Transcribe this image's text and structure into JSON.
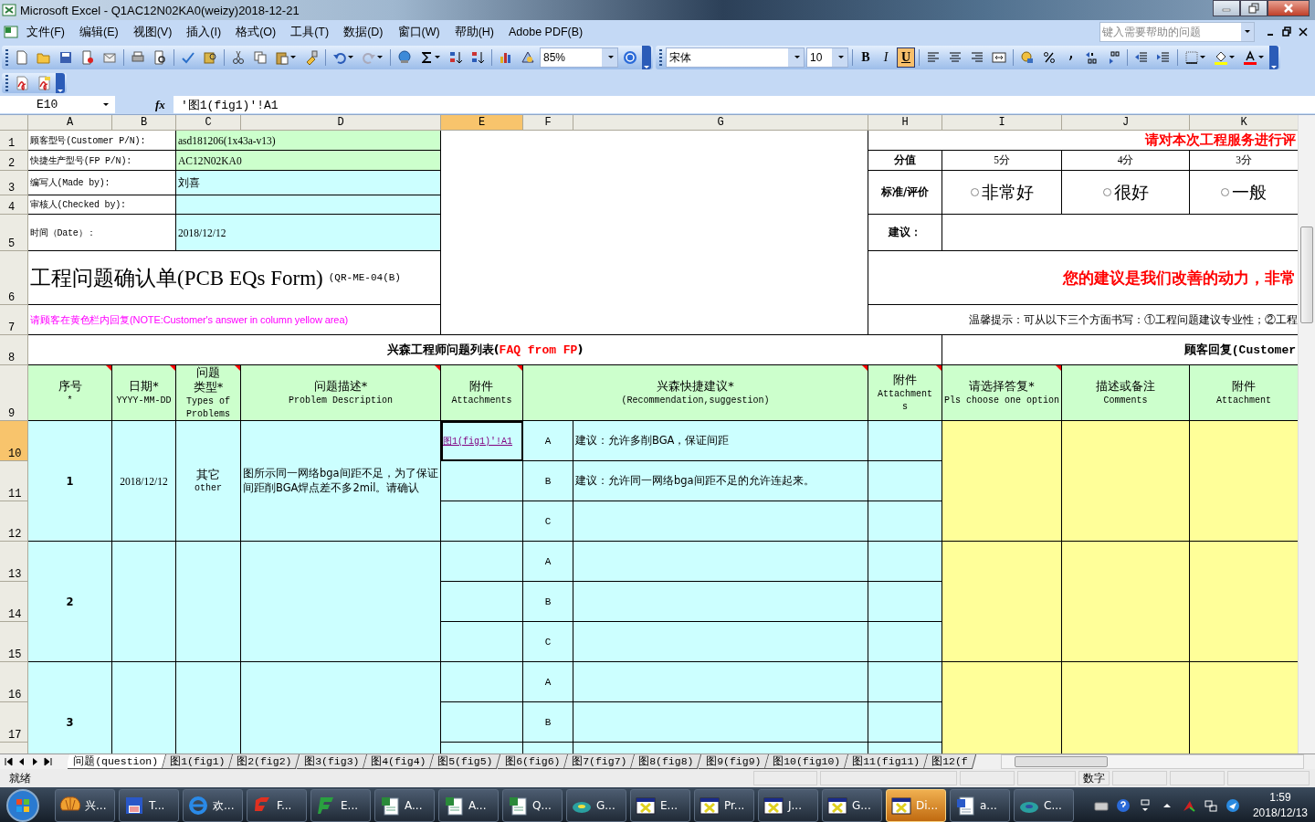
{
  "window": {
    "title": "Microsoft Excel - Q1AC12N02KA0(weizy)2018-12-21"
  },
  "menu": [
    "文件(F)",
    "编辑(E)",
    "视图(V)",
    "插入(I)",
    "格式(O)",
    "工具(T)",
    "数据(D)",
    "窗口(W)",
    "帮助(H)",
    "Adobe PDF(B)"
  ],
  "help_box": {
    "placeholder": "键入需要帮助的问题"
  },
  "toolbar": {
    "zoom": "85%",
    "font": "宋体",
    "font_size": "10",
    "format_buttons": [
      {
        "label": "B",
        "on": false
      },
      {
        "label": "I",
        "on": false
      },
      {
        "label": "U",
        "on": true
      }
    ]
  },
  "formula_bar": {
    "name_box": "E10",
    "fx": "fx",
    "formula": "'图1(fig1)'!A1"
  },
  "sheet": {
    "column_headers": [
      {
        "label": "A",
        "selected": false
      },
      {
        "label": "B",
        "selected": false
      },
      {
        "label": "C",
        "selected": false
      },
      {
        "label": "D",
        "selected": false
      },
      {
        "label": "E",
        "selected": true
      },
      {
        "label": "F",
        "selected": false
      },
      {
        "label": "G",
        "selected": false
      },
      {
        "label": "H",
        "selected": false
      },
      {
        "label": "I",
        "selected": false
      },
      {
        "label": "J",
        "selected": false
      },
      {
        "label": "K",
        "selected": false
      }
    ],
    "row_headers": [
      {
        "label": "1",
        "selected": false
      },
      {
        "label": "2",
        "selected": false
      },
      {
        "label": "3",
        "selected": false
      },
      {
        "label": "4",
        "selected": false
      },
      {
        "label": "5",
        "selected": false
      },
      {
        "label": "6",
        "selected": false
      },
      {
        "label": "7",
        "selected": false
      },
      {
        "label": "8",
        "selected": false
      },
      {
        "label": "9",
        "selected": false
      },
      {
        "label": "10",
        "selected": true
      },
      {
        "label": "11",
        "selected": false
      },
      {
        "label": "12",
        "selected": false
      },
      {
        "label": "13",
        "selected": false
      },
      {
        "label": "14",
        "selected": false
      },
      {
        "label": "15",
        "selected": false
      },
      {
        "label": "16",
        "selected": false
      },
      {
        "label": "17",
        "selected": false
      }
    ],
    "info": [
      {
        "label": "顾客型号(Customer P/N):",
        "value": "asd181206(1x43a-v13)",
        "color": "#ccffcc"
      },
      {
        "label": "快捷生产型号(FP P/N):",
        "value": "AC12N02KA0",
        "color": "#ccffcc"
      },
      {
        "label": "编写人(Made by):",
        "value": "刘喜",
        "color": "#ccffff"
      },
      {
        "label": "审核人(Checked by):",
        "color": "#ccffff"
      },
      {
        "label": "时间（Date）：",
        "value": "2018/12/12",
        "color": "#ccffff"
      }
    ],
    "title": "工程问题确认单(PCB EQs Form)",
    "form_code": "(QR-ME-04(B)",
    "note": "请顾客在黄色栏内回复(NOTE:Customer's answer in column yellow area)",
    "rating": {
      "heading": "请对本次工程服务进行评",
      "score_label": "分值",
      "criteria_label": "标准/评价",
      "options": [
        {
          "score": "5分",
          "label": "非常好",
          "selected": false
        },
        {
          "score": "4分",
          "label": "很好",
          "selected": false
        },
        {
          "score": "3分",
          "label": "一般",
          "selected": false
        }
      ],
      "suggestion_label": "建议：",
      "motto": "您的建议是我们改善的动力，非常",
      "tip": "温馨提示：可从以下三个方面书写：①工程问题建议专业性；②工程"
    },
    "faq_title": {
      "text": "兴森工程师问题列表(",
      "highlight": "FAQ from FP",
      "close": ")"
    },
    "customer_title": "顾客回复(Customer",
    "headers": [
      {
        "lines": [
          "序号",
          "*"
        ],
        "comment": true
      },
      {
        "lines": [
          "日期*",
          "YYYY-MM-DD"
        ],
        "comment": true
      },
      {
        "lines": [
          "问题",
          "类型*",
          "Types of",
          "Problems"
        ],
        "comment": true
      },
      {
        "lines": [
          "问题描述*",
          "Problem Description"
        ],
        "comment": true
      },
      {
        "lines": [
          "附件",
          "Attachments"
        ],
        "comment": true
      },
      {
        "lines": [
          "兴森快捷建议*",
          "(Recommendation,suggestion)"
        ],
        "comment": true
      },
      {
        "lines": [
          "附件",
          "Attachment",
          "s"
        ],
        "comment": true
      },
      {
        "lines": [
          "请选择答复*",
          "Pls choose one option"
        ],
        "comment": true
      },
      {
        "lines": [
          "描述或备注",
          "Comments"
        ],
        "comment": false
      },
      {
        "lines": [
          "附件",
          "Attachment"
        ],
        "comment": false
      }
    ],
    "questions": [
      {
        "number": "1",
        "date": "2018/12/12",
        "type": "其它",
        "type_en": "other",
        "description": "图所示同一网络bga间距不足，为了保证间距削BGA焊点差不多2mil。请确认",
        "options": [
          {
            "letter": "A",
            "attachment": "图1(fig1)'!A1",
            "suggestion": "建议：允许多削BGA，保证间距",
            "selected": true
          },
          {
            "letter": "B",
            "suggestion": "建议：允许同一网络bga间距不足的允许连起来。",
            "selected": false
          },
          {
            "letter": "C",
            "selected": false
          }
        ]
      },
      {
        "number": "2",
        "options": [
          {
            "letter": "A",
            "selected": false
          },
          {
            "letter": "B",
            "selected": false
          },
          {
            "letter": "C",
            "selected": false
          }
        ]
      },
      {
        "number": "3",
        "options": [
          {
            "letter": "A",
            "selected": false
          },
          {
            "letter": "B",
            "selected": false
          }
        ]
      }
    ]
  },
  "sheet_tabs": [
    {
      "label": "问题(question)",
      "selected": true
    },
    {
      "label": "图1(fig1)",
      "selected": false
    },
    {
      "label": "图2(fig2)",
      "selected": false
    },
    {
      "label": "图3(fig3)",
      "selected": false
    },
    {
      "label": "图4(fig4)",
      "selected": false
    },
    {
      "label": "图5(fig5)",
      "selected": false
    },
    {
      "label": "图6(fig6)",
      "selected": false
    },
    {
      "label": "图7(fig7)",
      "selected": false
    },
    {
      "label": "图8(fig8)",
      "selected": false
    },
    {
      "label": "图9(fig9)",
      "selected": false
    },
    {
      "label": "图10(fig10)",
      "selected": false
    },
    {
      "label": "图11(fig11)",
      "selected": false
    },
    {
      "label": "图12(f",
      "selected": false
    }
  ],
  "status_bar": {
    "text": "就绪",
    "num_lock": "数字"
  },
  "taskbar": {
    "items": [
      {
        "label": "兴...",
        "active": false
      },
      {
        "label": "T...",
        "active": false
      },
      {
        "label": "欢...",
        "active": false
      },
      {
        "label": "F...",
        "active": false
      },
      {
        "label": "E...",
        "active": false
      },
      {
        "label": "A...",
        "active": false
      },
      {
        "label": "A...",
        "active": false
      },
      {
        "label": "Q...",
        "active": false
      },
      {
        "label": "G...",
        "active": false
      },
      {
        "label": "E...",
        "active": false
      },
      {
        "label": "Pr...",
        "active": false
      },
      {
        "label": "J...",
        "active": false
      },
      {
        "label": "G...",
        "active": false
      },
      {
        "label": "Di...",
        "active": true
      },
      {
        "label": "a...",
        "active": false
      },
      {
        "label": "C...",
        "active": false
      }
    ],
    "time": "1:59",
    "date": "2018/12/13"
  }
}
